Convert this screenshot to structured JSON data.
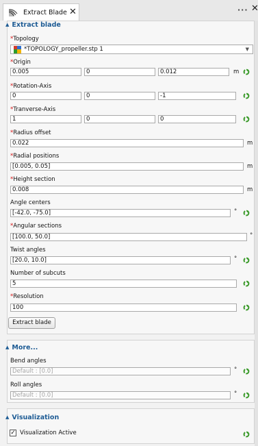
{
  "tab": {
    "title": "Extract Blade",
    "close_glyph": "✕",
    "more_glyph": "···",
    "window_close_glyph": "✕"
  },
  "extract_section": {
    "title": "Extract blade",
    "topology": {
      "label": "Topology",
      "value": "*TOPOLOGY_propeller.stp 1"
    },
    "origin": {
      "label": "Origin",
      "values": [
        "0.005",
        "0",
        "0.012"
      ],
      "unit": "m"
    },
    "rotation_axis": {
      "label": "Rotation-Axis",
      "values": [
        "0",
        "0",
        "-1"
      ]
    },
    "tranverse_axis": {
      "label": "Tranverse-Axis",
      "values": [
        "1",
        "0",
        "0"
      ]
    },
    "radius_offset": {
      "label": "Radius offset",
      "value": "0.022",
      "unit": "m"
    },
    "radial_positions": {
      "label": "Radial positions",
      "value": "[0.005, 0.05]",
      "unit": "m"
    },
    "height_section": {
      "label": "Height section",
      "value": "0.008",
      "unit": "m"
    },
    "angle_centers": {
      "label": "Angle centers",
      "value": "[-42.0, -75.0]",
      "unit": "°"
    },
    "angular_sections": {
      "label": "Angular sections",
      "value": "[100.0, 50.0]",
      "unit": "°"
    },
    "twist_angles": {
      "label": "Twist angles",
      "value": "[20.0, 10.0]",
      "unit": "°"
    },
    "number_of_subcuts": {
      "label": "Number of subcuts",
      "value": "5"
    },
    "resolution": {
      "label": "Resolution",
      "value": "100"
    },
    "button_label": "Extract blade"
  },
  "more_section": {
    "title": "More...",
    "bend_angles": {
      "label": "Bend angles",
      "placeholder": "Default : [0.0]",
      "unit": "°"
    },
    "roll_angles": {
      "label": "Roll angles",
      "placeholder": "Default : [0.0]",
      "unit": "°"
    }
  },
  "visualization_section": {
    "title": "Visualization",
    "checkbox_label": "Visualization Active",
    "checked_glyph": "✓"
  },
  "required_marker": "*",
  "caret_glyph": "▲",
  "dropdown_glyph": "▼",
  "colors": {
    "section_title": "#1d5b94",
    "required": "#d01010",
    "recycle": "#3a9a2a"
  }
}
